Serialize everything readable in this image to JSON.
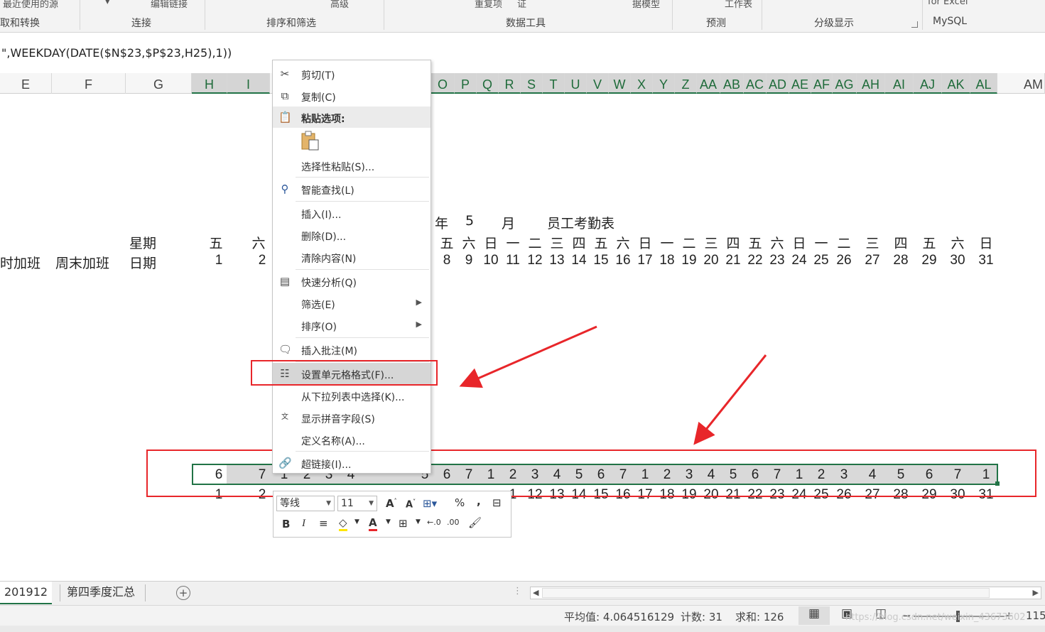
{
  "ribbon": {
    "top_row": [
      "最近使用的源",
      "编辑链接",
      "高级",
      "重复项",
      "证",
      "据模型",
      "工作表",
      "for Excel"
    ],
    "groups": [
      "取和转换",
      "连接",
      "排序和筛选",
      "数据工具",
      "预测",
      "分级显示",
      "MySQL"
    ]
  },
  "formula_bar": {
    "text": "\",WEEKDAY(DATE($N$23,$P$23,H25),1))"
  },
  "columns": [
    "E",
    "F",
    "G",
    "H",
    "I",
    "O",
    "P",
    "Q",
    "R",
    "S",
    "T",
    "U",
    "V",
    "W",
    "X",
    "Y",
    "Z",
    "AA",
    "AB",
    "AC",
    "AD",
    "AE",
    "AF",
    "AG",
    "AH",
    "AI",
    "AJ",
    "AK",
    "AL",
    "AM"
  ],
  "sheet": {
    "title_year": "年",
    "title_month_num": "5",
    "title_month": "月",
    "title_name": "员工考勤表",
    "label_weekday": "星期",
    "label_date": "日期",
    "label_overtime": "时加班",
    "label_weekend": "周末加班",
    "left_weekdays": [
      "五",
      "六"
    ],
    "left_dates": [
      "1",
      "2"
    ],
    "weekdays": [
      "五",
      "六",
      "日",
      "一",
      "二",
      "三",
      "四",
      "五",
      "六",
      "日",
      "一",
      "二",
      "三",
      "四",
      "五",
      "六",
      "日",
      "一",
      "二",
      "三",
      "四",
      "五",
      "六",
      "日"
    ],
    "dates": [
      "8",
      "9",
      "10",
      "11",
      "12",
      "13",
      "14",
      "15",
      "16",
      "17",
      "18",
      "19",
      "20",
      "21",
      "22",
      "23",
      "24",
      "25",
      "26",
      "27",
      "28",
      "29",
      "30",
      "31"
    ],
    "row25_left": [
      "6",
      "7",
      "1",
      "2",
      "3",
      "4"
    ],
    "row25_right": [
      "5",
      "6",
      "7",
      "1",
      "2",
      "3",
      "4",
      "5",
      "6",
      "7",
      "1",
      "2",
      "3",
      "4",
      "5",
      "6",
      "7",
      "1",
      "2",
      "3",
      "4",
      "5",
      "6",
      "7",
      "1"
    ],
    "row26_left": [
      "1",
      "2"
    ],
    "row26_right": [
      "1",
      "12",
      "13",
      "14",
      "15",
      "16",
      "17",
      "18",
      "19",
      "20",
      "21",
      "22",
      "23",
      "24",
      "25",
      "26",
      "27",
      "28",
      "29",
      "30",
      "31"
    ]
  },
  "context_menu": {
    "cut": "剪切(T)",
    "copy": "复制(C)",
    "paste_options": "粘贴选项:",
    "paste_special": "选择性粘贴(S)...",
    "smart_lookup": "智能查找(L)",
    "insert": "插入(I)...",
    "delete": "删除(D)...",
    "clear": "清除内容(N)",
    "quick_analysis": "快速分析(Q)",
    "filter": "筛选(E)",
    "sort": "排序(O)",
    "insert_comment": "插入批注(M)",
    "format_cells": "设置单元格格式(F)...",
    "pick_from_list": "从下拉列表中选择(K)...",
    "phonetic": "显示拼音字段(S)",
    "define_name": "定义名称(A)...",
    "hyperlink": "超链接(I)..."
  },
  "mini_toolbar": {
    "font": "等线",
    "size": "11"
  },
  "sheet_tabs": [
    "201912",
    "第四季度汇总"
  ],
  "status_bar": {
    "average": "平均值: 4.064516129",
    "count": "计数: 31",
    "sum": "求和: 126",
    "zoom": "115",
    "watermark": "https://blog.csdn.net/weixin_43673602"
  },
  "colors": {
    "accent": "#217346",
    "highlight_red": "#e8262a"
  }
}
